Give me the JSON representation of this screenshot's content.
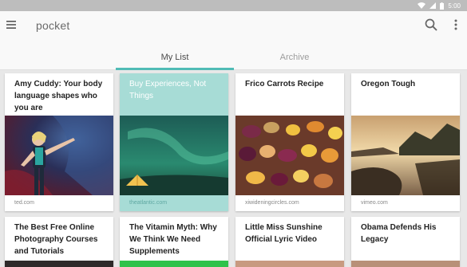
{
  "status_bar": {
    "time": "5:00"
  },
  "app_bar": {
    "title": "pocket",
    "menu_icon": "hamburger-menu-icon",
    "search_icon": "search-icon",
    "more_icon": "more-vert-icon"
  },
  "tabs": [
    {
      "label": "My List",
      "selected": true
    },
    {
      "label": "Archive",
      "selected": false
    }
  ],
  "colors": {
    "accent": "#50bcb6",
    "highlight_card": "#a7dcd6"
  },
  "cards": [
    {
      "title": "Amy Cuddy: Your body language shapes who you are",
      "source": "ted.com",
      "image": "speaker on stage"
    },
    {
      "title": "Buy Experiences, Not Things",
      "source": "theatlantic.com",
      "image": "tent under northern lights",
      "highlighted": true
    },
    {
      "title": "Frico Carrots Recipe",
      "source": "xiwideningcircles.com",
      "image": "roasted carrots"
    },
    {
      "title": "Oregon Tough",
      "source": "vimeo.com",
      "image": "lake at sunset"
    },
    {
      "title": "The Best Free Online Photography Courses and Tutorials"
    },
    {
      "title": "The Vitamin Myth: Why We Think We Need Supplements"
    },
    {
      "title": "Little Miss Sunshine Official Lyric Video"
    },
    {
      "title": "Obama Defends His Legacy"
    }
  ]
}
